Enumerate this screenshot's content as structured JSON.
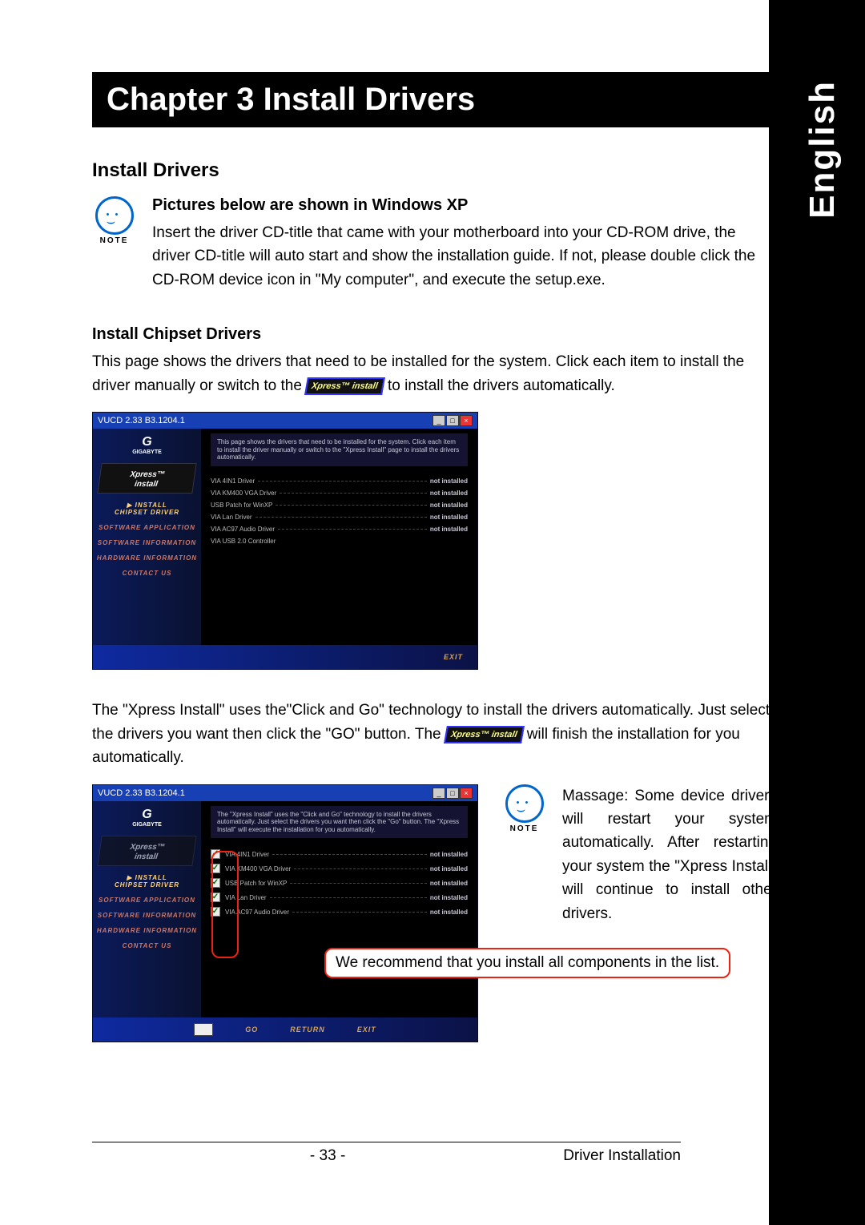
{
  "language_tab": "English",
  "chapter_title": "Chapter 3  Install Drivers",
  "section1_title": "Install Drivers",
  "note_label": "NOTE",
  "notice_heading": "Pictures below are shown in Windows XP",
  "notice_body": "Insert the driver CD-title that came with your motherboard into your CD-ROM drive, the driver CD-title will auto start and show the installation guide. If not, please double click the CD-ROM device icon in \"My computer\", and execute the setup.exe.",
  "section2_title": "Install Chipset Drivers",
  "para_a1": "This page shows the drivers that need to be installed for the system. Click each item to install the driver manually or switch to the ",
  "para_a2": " to install the drivers automatically.",
  "xpress_badge_top": "Xpress™",
  "xpress_badge_bottom": "install",
  "win_title": "VUCD 2.33 B3.1204.1",
  "logo_brand": "G",
  "logo_sub": "GIGABYTE",
  "nav": {
    "install": "▶ INSTALL",
    "chipset": "CHIPSET DRIVER",
    "swapp": "SOFTWARE APPLICATION",
    "swinfo": "SOFTWARE INFORMATION",
    "hwinfo": "HARDWARE INFORMATION",
    "contact": "CONTACT US"
  },
  "content_header1": "This page shows the drivers that need to be installed for the system. Click each item to install the driver manually or switch to the \"Xpress Install\" page to install the drivers automatically.",
  "content_header2": "The \"Xpress Install\" uses the \"Click and Go\" technology to install the drivers automatically. Just select the drivers you want then click the \"Go\" button. The \"Xpress Install\" will execute the installation for you automatically.",
  "status_not_installed": "not installed",
  "drivers": [
    "VIA 4IN1 Driver",
    "VIA KM400 VGA Driver",
    "USB Patch for WinXP",
    "VIA Lan Driver",
    "VIA AC97 Audio Driver"
  ],
  "driver_extra": "VIA USB 2.0 Controller",
  "footer_buttons": {
    "go": "GO",
    "return": "RETURN",
    "exit": "EXIT"
  },
  "para_b1": "The \"Xpress Install\" uses the\"Click and Go\" technology to install the drivers automatically. Just select the drivers you want then click the \"GO\" button. The ",
  "para_b2": " will finish the installation for you automatically.",
  "massage_note": "Massage: Some device drivers will restart your system automatically. After restarting your system the \"Xpress Install\" will continue to install other drivers.",
  "callout": "We recommend that you install all components in the list.",
  "page_number": "- 33 -",
  "footer_label": "Driver Installation"
}
